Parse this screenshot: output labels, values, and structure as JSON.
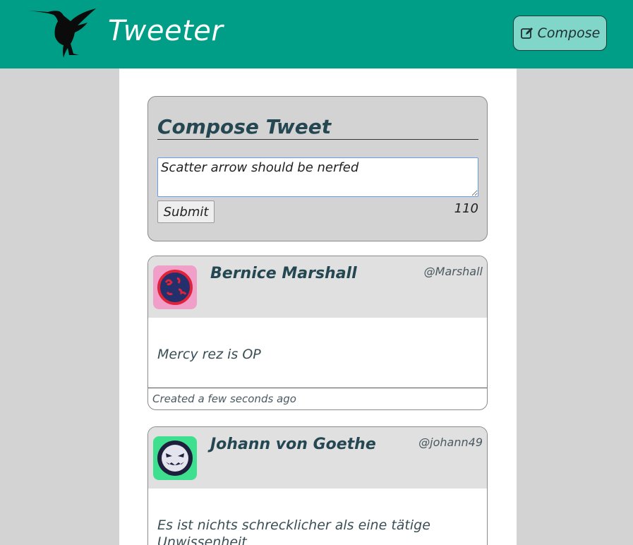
{
  "header": {
    "brand": "Tweeter",
    "compose_label": "Compose"
  },
  "compose": {
    "title": "Compose Tweet",
    "text": "Scatter arrow should be nerfed",
    "submit_label": "Submit",
    "remaining": "110"
  },
  "tweets": [
    {
      "name": "Bernice Marshall",
      "handle": "@Marshall",
      "content": "Mercy rez is OP",
      "created": "Created a few seconds ago",
      "avatar_bg": "#f0a0c8",
      "avatar_icon": "red-blue-face-avatar"
    },
    {
      "name": "Johann von Goethe",
      "handle": "@johann49",
      "content": "Es ist nichts schrecklicher als eine tätige Unwissenheit",
      "created": "",
      "avatar_bg": "#3ee08f",
      "avatar_icon": "grinning-monster-avatar"
    }
  ],
  "colors": {
    "topbar": "#009e86",
    "compose_button": "#7fd6c9",
    "page_bg": "#d3d3d3",
    "text_dark": "#244751"
  }
}
